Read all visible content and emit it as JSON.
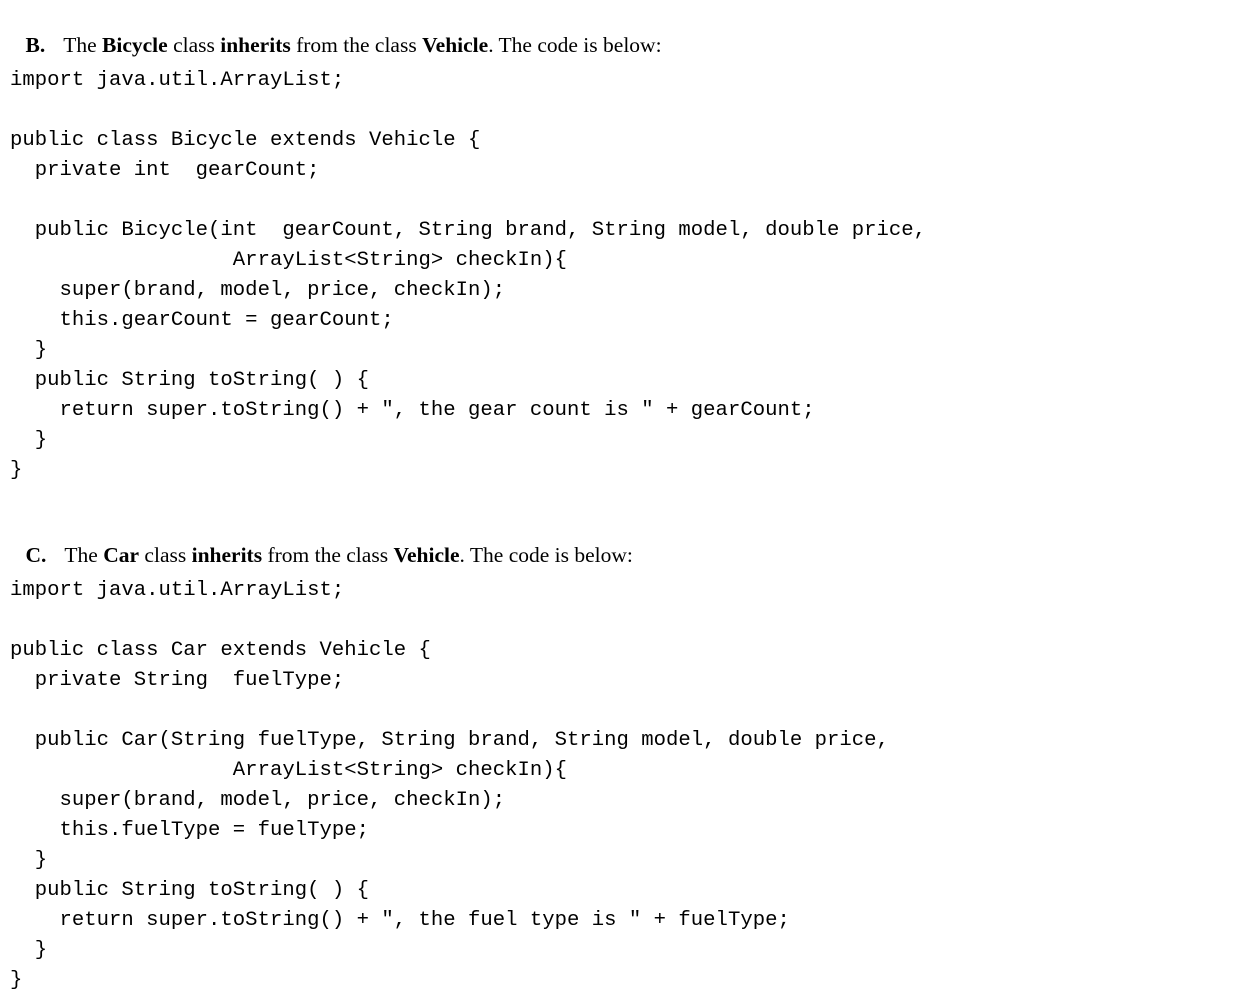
{
  "document": {
    "background_color": "#ffffff",
    "text_color": "#000000",
    "sections": [
      {
        "label": "B.",
        "heading_parts": [
          {
            "text": "The ",
            "bold": false
          },
          {
            "text": "Bicycle",
            "bold": true
          },
          {
            "text": " class ",
            "bold": false
          },
          {
            "text": "inherits",
            "bold": true
          },
          {
            "text": " from the class ",
            "bold": false
          },
          {
            "text": "Vehicle",
            "bold": true
          },
          {
            "text": ". The code is below:",
            "bold": false
          }
        ],
        "heading_plain": "B.  The Bicycle class inherits from the class Vehicle. The code is below:",
        "code_lines": [
          "import java.util.ArrayList;",
          "",
          "public class Bicycle extends Vehicle {",
          "  private int  gearCount;",
          "",
          "  public Bicycle(int  gearCount, String brand, String model, double price,",
          "                  ArrayList<String> checkIn){",
          "    super(brand, model, price, checkIn);",
          "    this.gearCount = gearCount;",
          "  }",
          "  public String toString( ) {",
          "    return super.toString() + \", the gear count is \" + gearCount;",
          "  }",
          "}"
        ]
      },
      {
        "label": "C.",
        "heading_parts": [
          {
            "text": "The ",
            "bold": false
          },
          {
            "text": "Car",
            "bold": true
          },
          {
            "text": " class ",
            "bold": false
          },
          {
            "text": "inherits",
            "bold": true
          },
          {
            "text": " from the class ",
            "bold": false
          },
          {
            "text": "Vehicle",
            "bold": true
          },
          {
            "text": ". The code is below:",
            "bold": false
          }
        ],
        "heading_plain": "C.  The Car class inherits from the class Vehicle. The code is below:",
        "code_lines": [
          "import java.util.ArrayList;",
          "",
          "public class Car extends Vehicle {",
          "  private String  fuelType;",
          "",
          "  public Car(String fuelType, String brand, String model, double price,",
          "                  ArrayList<String> checkIn){",
          "    super(brand, model, price, checkIn);",
          "    this.fuelType = fuelType;",
          "  }",
          "  public String toString( ) {",
          "    return super.toString() + \", the fuel type is \" + fuelType;",
          "  }",
          "}"
        ]
      }
    ]
  }
}
